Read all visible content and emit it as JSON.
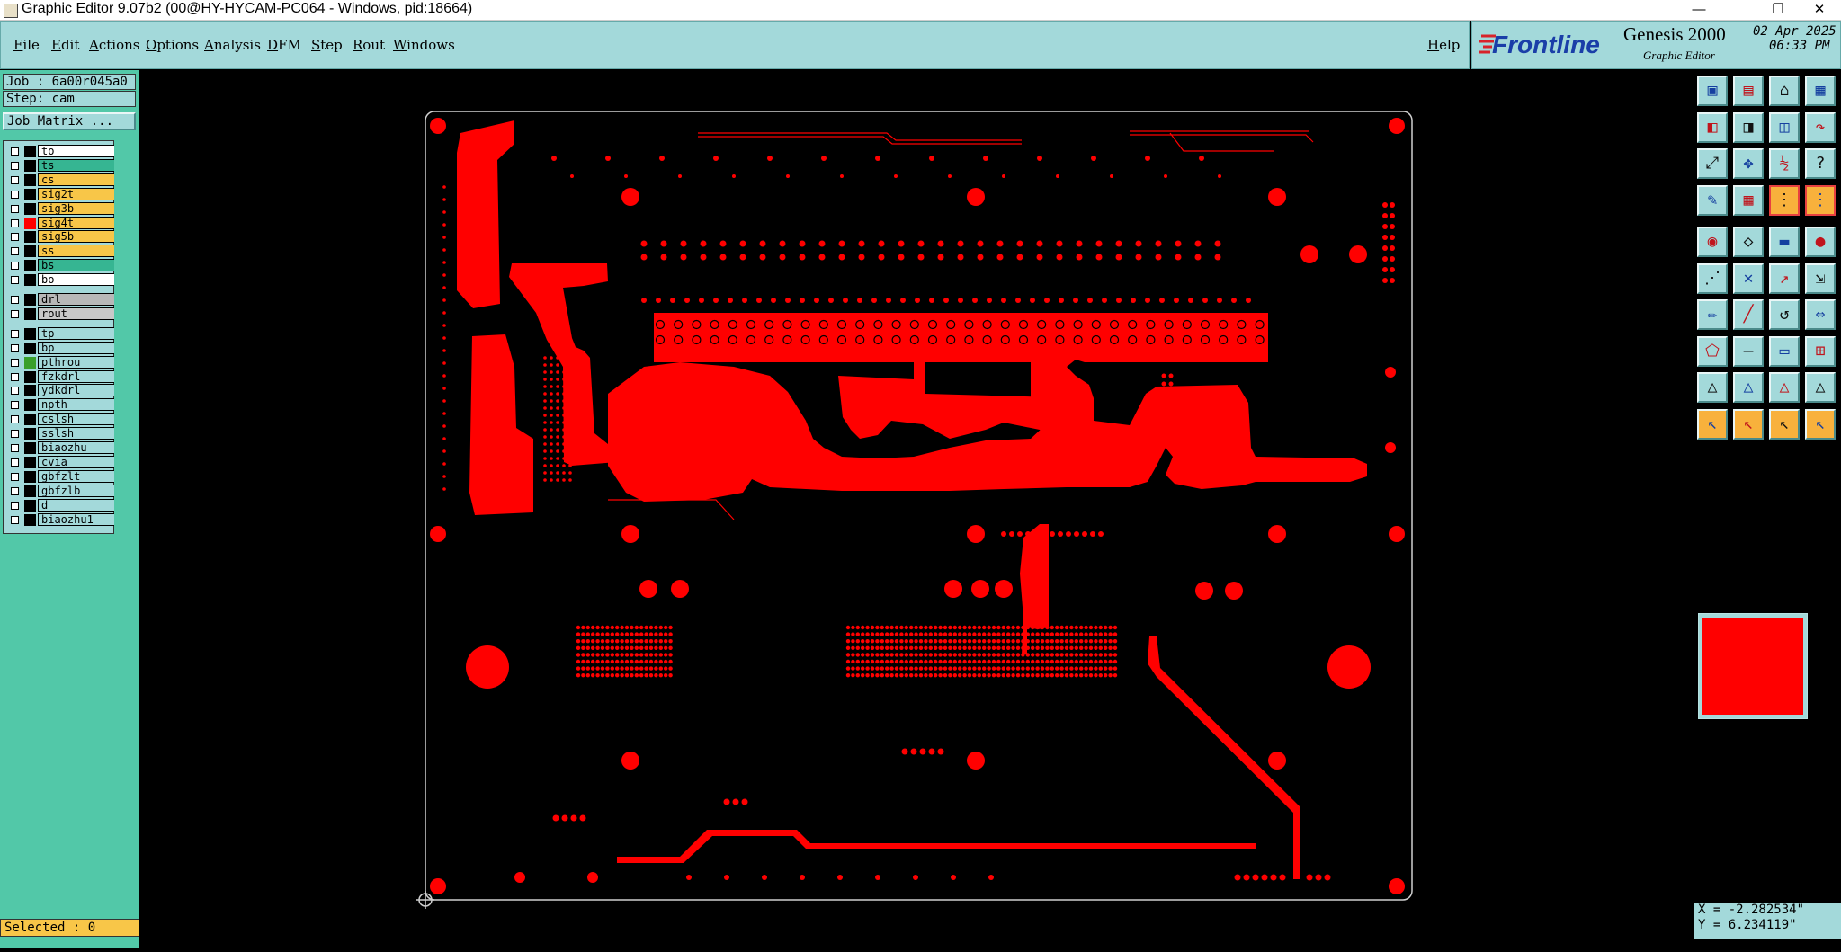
{
  "window": {
    "title": "Graphic Editor 9.07b2 (00@HY-HYCAM-PC064 - Windows, pid:18664)",
    "minimize": "—",
    "restore": "❐",
    "close": "✕"
  },
  "menu": {
    "items": [
      "File",
      "Edit",
      "Actions",
      "Options",
      "Analysis",
      "DFM",
      "Step",
      "Rout",
      "Windows"
    ],
    "help": "Help"
  },
  "brand": {
    "logo": "Frontline",
    "product": "Genesis 2000",
    "subtitle": "Graphic Editor",
    "date": "02 Apr 2025",
    "time": "06:33 PM"
  },
  "job": {
    "job_label": "Job : 6a00r045a0",
    "step_label": "Step: cam",
    "matrix_button": "Job Matrix ..."
  },
  "layers": [
    {
      "name": "to",
      "color": "#ffffff",
      "swatch": "#000000"
    },
    {
      "name": "ts",
      "color": "#36b592",
      "swatch": "#000000"
    },
    {
      "name": "cs",
      "color": "#f8c648",
      "swatch": "#000000"
    },
    {
      "name": "sig2t",
      "color": "#f8c648",
      "swatch": "#000000"
    },
    {
      "name": "sig3b",
      "color": "#f8c648",
      "swatch": "#000000"
    },
    {
      "name": "sig4t",
      "color": "#f8c648",
      "swatch": "#ff0000"
    },
    {
      "name": "sig5b",
      "color": "#f8c648",
      "swatch": "#000000"
    },
    {
      "name": "ss",
      "color": "#f8c648",
      "swatch": "#000000"
    },
    {
      "name": "bs",
      "color": "#36b592",
      "swatch": "#000000"
    },
    {
      "name": "bo",
      "color": "#ffffff",
      "swatch": "#000000"
    },
    {
      "name": "drl",
      "color": "#b8b8b8",
      "swatch": "#000000"
    },
    {
      "name": "rout",
      "color": "#c8c8c8",
      "swatch": "#000000"
    },
    {
      "name": "tp",
      "color": "#a3d9da",
      "swatch": "#000000"
    },
    {
      "name": "bp",
      "color": "#a3d9da",
      "swatch": "#000000"
    },
    {
      "name": "pthrou",
      "color": "#a3d9da",
      "swatch": "#39a02a"
    },
    {
      "name": "fzkdrl",
      "color": "#a3d9da",
      "swatch": "#000000"
    },
    {
      "name": "ydkdrl",
      "color": "#a3d9da",
      "swatch": "#000000"
    },
    {
      "name": "npth",
      "color": "#a3d9da",
      "swatch": "#000000"
    },
    {
      "name": "cslsh",
      "color": "#a3d9da",
      "swatch": "#000000"
    },
    {
      "name": "sslsh",
      "color": "#a3d9da",
      "swatch": "#000000"
    },
    {
      "name": "biaozhu",
      "color": "#a3d9da",
      "swatch": "#000000"
    },
    {
      "name": "cvia",
      "color": "#a3d9da",
      "swatch": "#000000"
    },
    {
      "name": "gbfzlt",
      "color": "#a3d9da",
      "swatch": "#000000"
    },
    {
      "name": "gbfzlb",
      "color": "#a3d9da",
      "swatch": "#000000"
    },
    {
      "name": "d",
      "color": "#a3d9da",
      "swatch": "#000000"
    },
    {
      "name": "biaozhu1",
      "color": "#a3d9da",
      "swatch": "#000000"
    }
  ],
  "status": {
    "selected": "Selected : 0"
  },
  "coords": {
    "x": "X = -2.282534\"",
    "y": "Y = 6.234119\""
  },
  "colors": {
    "menu_bg": "#a3d9da",
    "panel_bg": "#52c8a8",
    "copper": "#ff0000",
    "canvas": "#000000"
  },
  "toolbar_icons": [
    "open-step-icon",
    "save-icon",
    "home-icon",
    "layout-icon",
    "import-icon",
    "export-icon",
    "copy-icon",
    "redo-icon",
    "zoom-fit-icon",
    "zoom-center-icon",
    "half-icon",
    "help-icon",
    "measure-icon",
    "grid-icon",
    "snap-icon",
    "snap2-icon",
    "display-icon",
    "shape-icon",
    "line-style-icon",
    "pad-icon",
    "connect-icon",
    "delete-icon",
    "move-icon",
    "copy-feature-icon",
    "pencil-icon",
    "draw-line-icon",
    "arc-icon",
    "resize-icon",
    "polygon-icon",
    "minus-icon",
    "attribute-icon",
    "net-icon",
    "analysis1-icon",
    "analysis2-icon",
    "analysis3-icon",
    "analysis4-icon",
    "select-icon",
    "select-plus-icon",
    "select-box-icon",
    "select-net-icon"
  ]
}
